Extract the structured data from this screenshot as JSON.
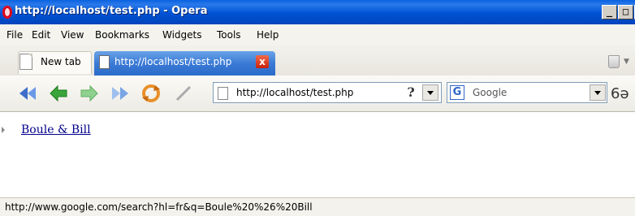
{
  "window": {
    "title": "http://localhost/test.php - Opera",
    "controls": {
      "minimize": "_",
      "maximize": "□",
      "close": "×"
    }
  },
  "menu": {
    "items": [
      {
        "label": "File"
      },
      {
        "label": "Edit"
      },
      {
        "label": "View"
      },
      {
        "label": "Bookmarks"
      },
      {
        "label": "Widgets"
      },
      {
        "label": "Tools"
      },
      {
        "label": "Help"
      }
    ]
  },
  "tabs": {
    "new_tab_label": "New tab",
    "active_tab_label": "http://localhost/test.php",
    "close_icon": "x",
    "trash_icon": "trash-icon"
  },
  "navigation": {
    "buttons": [
      "rewind-icon",
      "back-icon",
      "forward-icon",
      "fast-forward-icon",
      "reload-icon",
      "edit-icon"
    ],
    "address": "http://localhost/test.php",
    "help_glyph": "?",
    "search_engine_icon": "G",
    "search_placeholder": "Google",
    "voice_icon": "6ə"
  },
  "page": {
    "link_text": "Boule & Bill"
  },
  "status": {
    "text": "http://www.google.com/search?hl=fr&q=Boule%20%26%20Bill"
  },
  "colors": {
    "titlebar": "#0052d4",
    "active_tab": "#3b7bd6",
    "link": "#00008b",
    "tab_close": "#c8220a"
  }
}
